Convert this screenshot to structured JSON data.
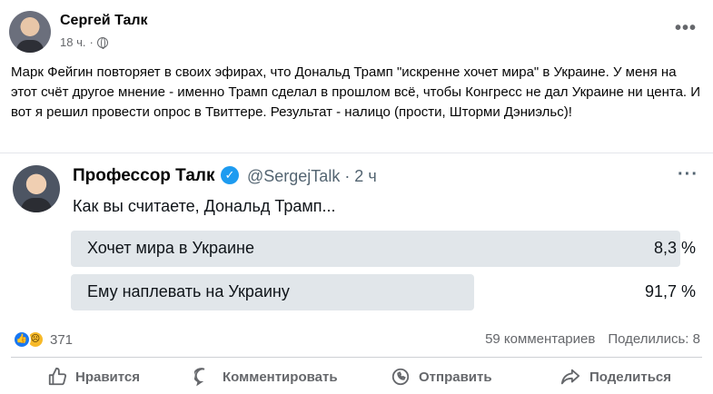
{
  "post": {
    "author": "Сергей Талк",
    "time": "18 ч.",
    "text": "Марк Фейгин повторяет в своих эфирах, что Дональд Трамп \"искренне хочет мира\" в Украине. У меня на этот счёт другое мнение - именно Трамп сделал в прошлом всё, чтобы Конгресс не дал Украине ни цента. И вот я решил провести опрос в Твиттере. Результат - налицо (прости, Шторми Дэниэльс)!",
    "more_icon": "more-horizontal-icon"
  },
  "tweet": {
    "name": "Профессор Талк",
    "handle": "@SergejTalk · 2 ч",
    "question": "Как вы считаете, Дональд Трамп...",
    "verified_color": "#1d9bf0",
    "poll": [
      {
        "label": "Хочет мира в Украине",
        "pct_text": "8,3 %",
        "pct": 8.3
      },
      {
        "label": "Ему наплевать на Украину",
        "pct_text": "91,7 %",
        "pct": 91.7
      }
    ]
  },
  "reactions": {
    "count": "371",
    "icons": [
      "like-icon",
      "sad-icon"
    ]
  },
  "stats": {
    "comments": "59 комментариев",
    "shares": "Поделились: 8"
  },
  "actions": {
    "like": "Нравится",
    "comment": "Комментировать",
    "send": "Отправить",
    "share": "Поделиться"
  }
}
